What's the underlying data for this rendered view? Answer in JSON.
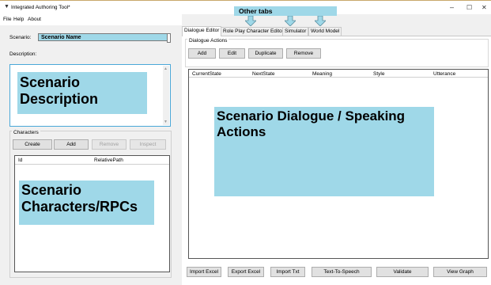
{
  "window": {
    "title": "Integrated Authoring Tool*",
    "controls": {
      "minimize": "–",
      "maximize": "☐",
      "close": "✕"
    }
  },
  "menu": [
    "File",
    "Help",
    "About"
  ],
  "left_panel": {
    "scenario_label": "Scenario:",
    "scenario_value": "Scenario Name",
    "description_label": "Description:",
    "description_annotation": "Scenario Description",
    "characters": {
      "group_label": "Characters",
      "buttons": [
        {
          "label": "Create",
          "enabled": true
        },
        {
          "label": "Add",
          "enabled": true
        },
        {
          "label": "Remove",
          "enabled": false
        },
        {
          "label": "Inspect",
          "enabled": false
        }
      ],
      "columns": [
        "Id",
        "RelativePath"
      ],
      "annotation": "Scenario Characters/RPCs"
    }
  },
  "annotations": {
    "other_tabs": "Other tabs"
  },
  "tabs": [
    {
      "label": "Dialogue Editor",
      "active": true
    },
    {
      "label": "Role Play Character Editor",
      "active": false
    },
    {
      "label": "Simulator",
      "active": false
    },
    {
      "label": "World Model",
      "active": false
    }
  ],
  "dialogue_editor": {
    "group_label": "Dialogue Actions",
    "buttons": [
      "Add",
      "Edit",
      "Duplicate",
      "Remove"
    ],
    "columns": [
      "CurrentState",
      "NextState",
      "Meaning",
      "Style",
      "Utterance"
    ],
    "annotation": "Scenario Dialogue / Speaking Actions",
    "bottom_buttons": [
      "Import Excel",
      "Export Excel",
      "Import Txt",
      "Text-To-Speech",
      "Validate",
      "View Graph"
    ]
  },
  "colors": {
    "annotation_fill": "#9fd8e8",
    "arrow_fill": "#9fd8e8",
    "focus_border": "#4aa8d8"
  }
}
